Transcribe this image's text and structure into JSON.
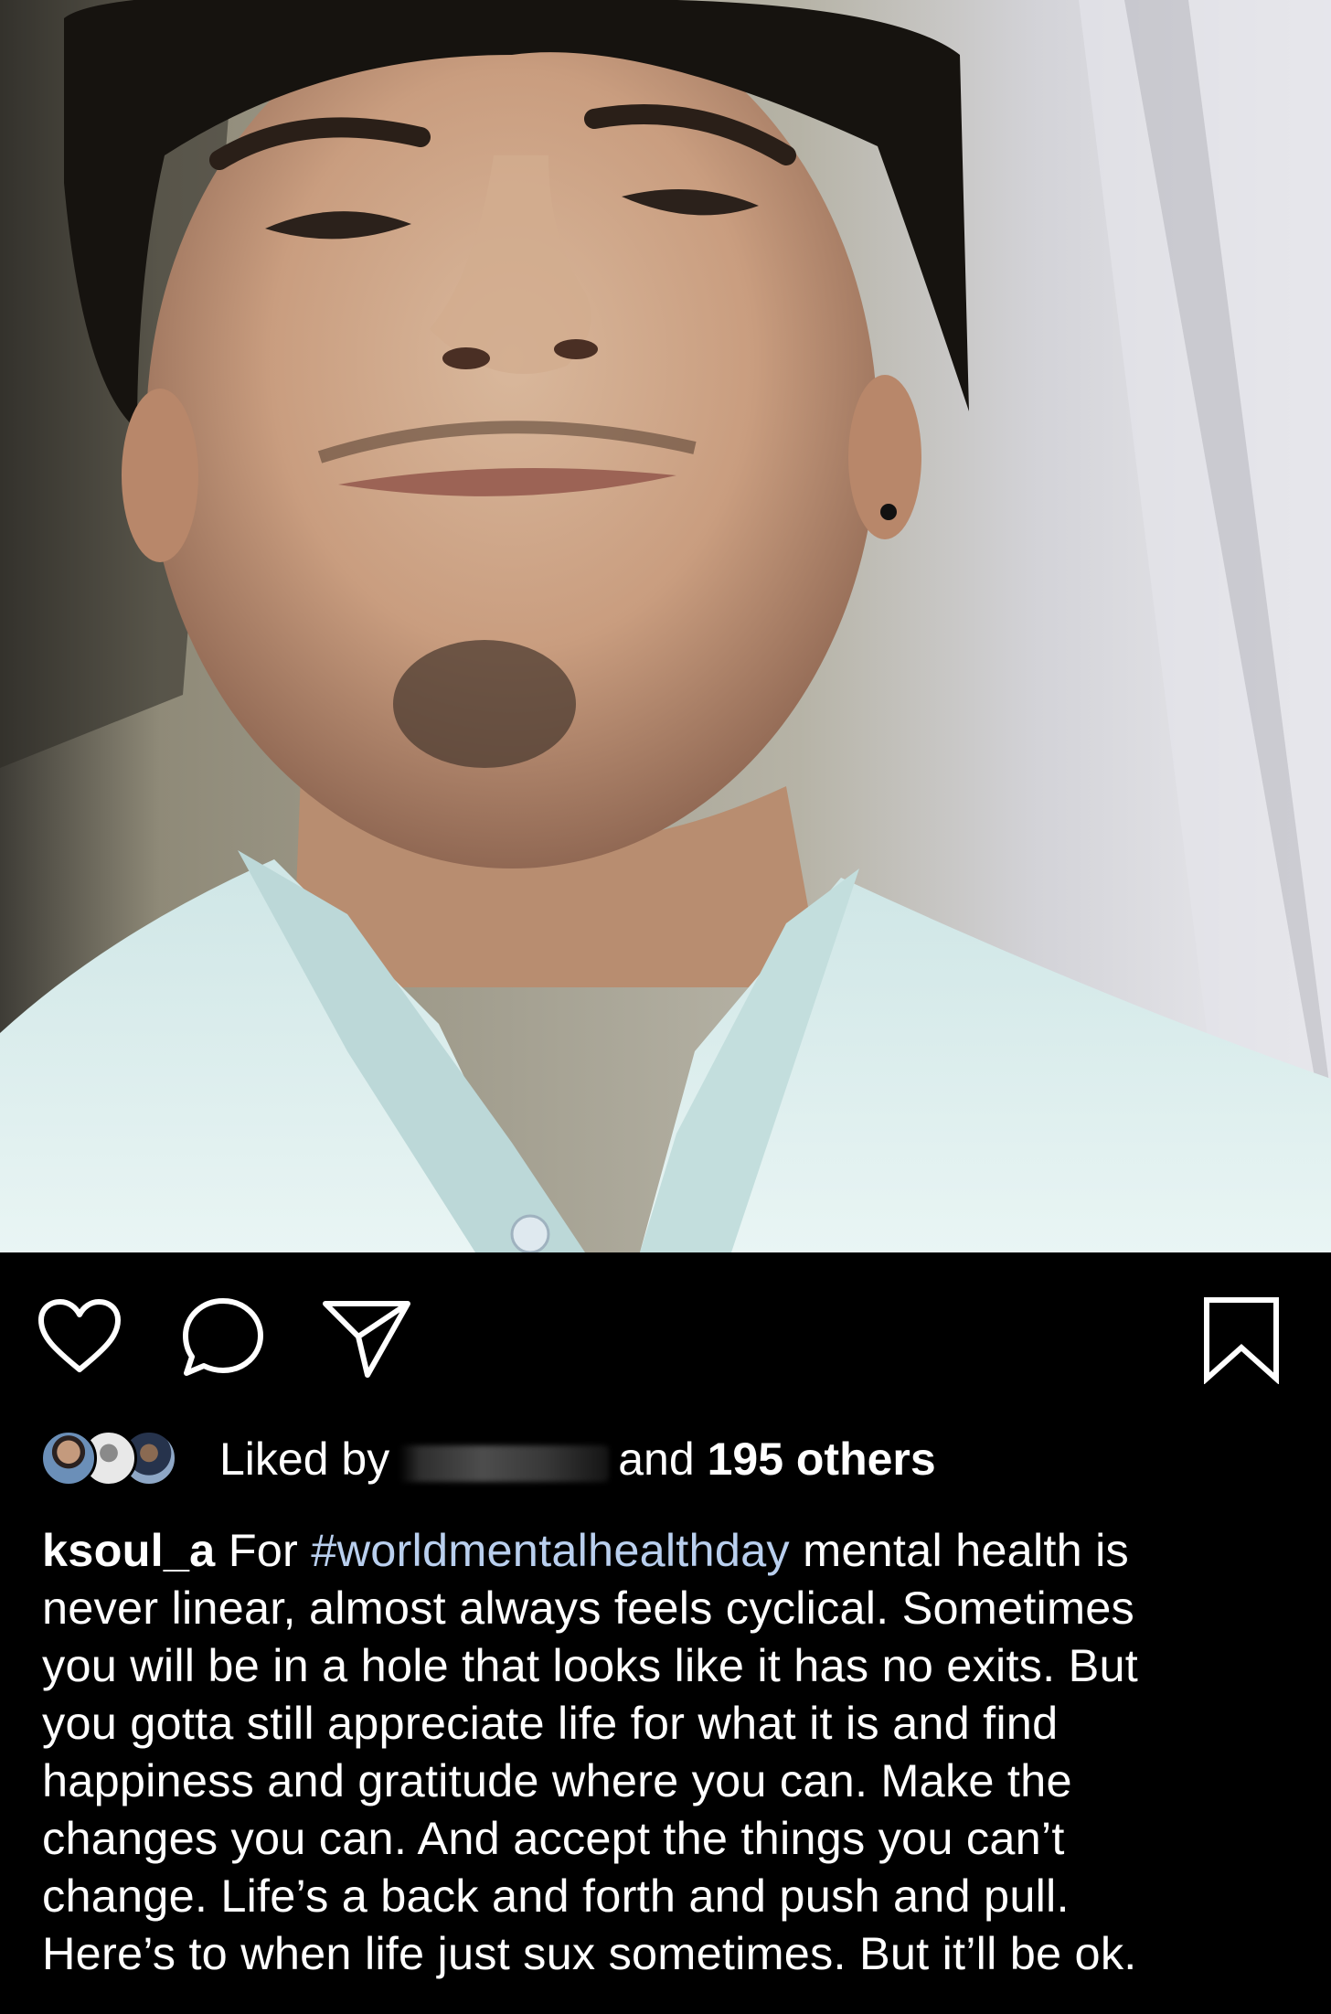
{
  "post": {
    "photo_alt": "selfie",
    "actions": {
      "like": "heart-icon",
      "comment": "comment-icon",
      "share": "share-icon",
      "save": "bookmark-icon"
    },
    "likes": {
      "prefix": "Liked by",
      "connector": "and",
      "count": "195 others"
    },
    "caption": {
      "username": "ksoul_a",
      "text_before": "For",
      "hashtag": "#worldmentalhealthday",
      "lines": [
        "mental health is",
        "never linear, almost always feels cyclical.  Sometimes",
        "you will be in a hole that looks like it has no exits. But",
        "you gotta still appreciate life for what it is and find",
        "happiness and gratitude where you can. Make the",
        "changes you can. And accept the things you can’t",
        "change. Life’s a back and forth and push and pull.",
        "Here’s to when life just sux sometimes. But it’ll be ok."
      ]
    },
    "colors": {
      "background": "#000000",
      "text": "#ffffff",
      "hashtag": "#b9cfee"
    }
  }
}
